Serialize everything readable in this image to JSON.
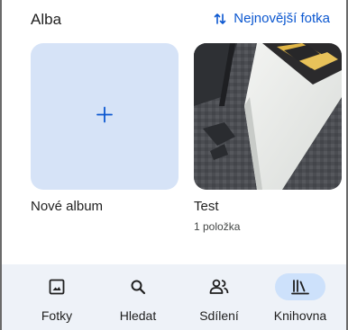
{
  "header": {
    "title": "Alba",
    "sort_label": "Nejnovější fotka",
    "sort_icon": "swap-vert-icon"
  },
  "albums": [
    {
      "title": "Nové album",
      "icon": "plus-icon"
    },
    {
      "title": "Test",
      "count": "1 položka"
    }
  ],
  "bottom_nav": {
    "items": [
      {
        "label": "Fotky",
        "icon": "photo-icon"
      },
      {
        "label": "Hledat",
        "icon": "search-icon"
      },
      {
        "label": "Sdílení",
        "icon": "people-icon"
      },
      {
        "label": "Knihovna",
        "icon": "library-icon",
        "active": true
      }
    ]
  },
  "colors": {
    "accent": "#0b57d0",
    "new_album_bg": "#d6e3f7",
    "nav_bg": "#eef2f8",
    "active_pill": "#cde1fb"
  }
}
